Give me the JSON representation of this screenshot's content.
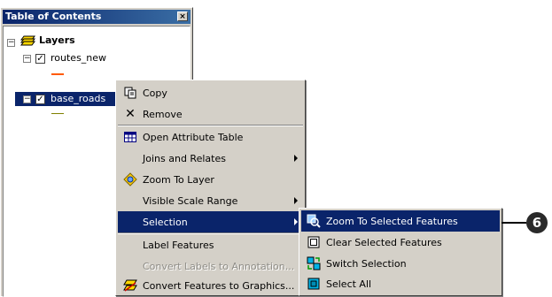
{
  "window": {
    "title": "Table of Contents",
    "close_glyph": "⊠"
  },
  "tree": {
    "root_label": "Layers",
    "layer1": {
      "label": "routes_new",
      "symbol_color": "#ff5a00"
    },
    "layer2": {
      "label": "base_roads",
      "symbol_color": "#808000"
    }
  },
  "context_menu": [
    {
      "label": "Copy",
      "ul": "C",
      "icon": "copy-icon"
    },
    {
      "label": "Remove",
      "ul": "R",
      "icon": "remove-icon"
    },
    {
      "label": "Open Attribute Table",
      "icon": "table-icon"
    },
    {
      "label": "Joins and Relates",
      "submenu": true
    },
    {
      "label": "Zoom To Layer",
      "icon": "zoom-layer-icon"
    },
    {
      "label": "Visible Scale Range",
      "submenu": true
    },
    {
      "label": "Selection",
      "submenu": true,
      "highlighted": true
    },
    {
      "label": "Label Features"
    },
    {
      "label": "Convert Labels to Annotation...",
      "disabled": true
    },
    {
      "label": "Convert Features to Graphics...",
      "icon": "convert-graphics-icon"
    }
  ],
  "submenu": [
    {
      "label": "Zoom To Selected Features",
      "highlighted": true,
      "icon": "zoom-selected-icon"
    },
    {
      "label": "Clear Selected Features",
      "icon": "clear-selection-icon"
    },
    {
      "label": "Switch Selection",
      "icon": "switch-selection-icon"
    },
    {
      "label": "Select All",
      "icon": "select-all-icon"
    }
  ],
  "callout": {
    "number": "6"
  },
  "colors": {
    "highlight": "#0a246a",
    "menu_bg": "#d4d0c8"
  }
}
